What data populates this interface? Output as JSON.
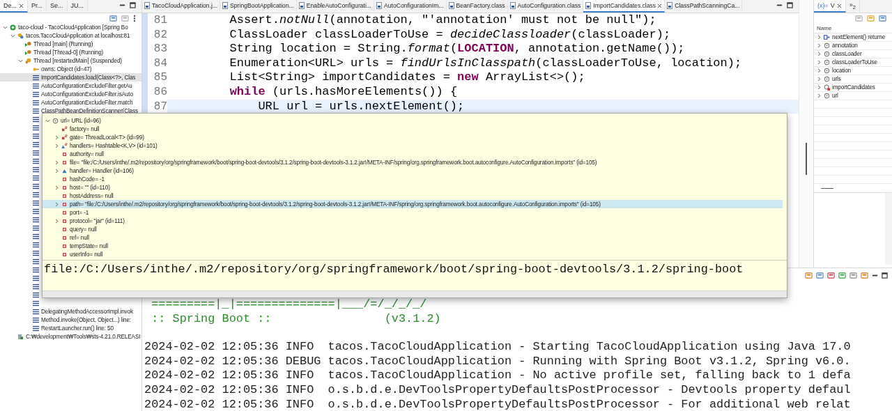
{
  "debug_view": {
    "tabs": [
      {
        "label": "De...",
        "selected": true,
        "closable": true
      },
      {
        "label": "Pr...",
        "selected": false,
        "closable": false
      },
      {
        "label": "Se...",
        "selected": false,
        "closable": false
      },
      {
        "label": "JU...",
        "selected": false,
        "closable": false
      }
    ],
    "tree": [
      {
        "label": "taco-cloud - TacoCloudApplication [Spring Bo",
        "kind": "launch",
        "expanded": true,
        "children": [
          {
            "label": "tacos.TacoCloudApplication at localhost:81",
            "kind": "process",
            "expanded": true,
            "children": [
              {
                "label": "Thread [main] (Running)",
                "kind": "thread"
              },
              {
                "label": "Thread [Thread-0] (Running)",
                "kind": "thread"
              },
              {
                "label": "Thread [restartedMain] (Suspended)",
                "kind": "suspended",
                "expanded": true,
                "children": [
                  {
                    "label": "owns: Object  (id=47)",
                    "kind": "monitor",
                    "selected": false
                  },
                  {
                    "label": "ImportCandidates.load(Class<?>, Clas",
                    "kind": "frame",
                    "selected": true
                  },
                  {
                    "label": "AutoConfigurationExcludeFilter.getAu",
                    "kind": "frame",
                    "selected": false
                  },
                  {
                    "label": "AutoConfigurationExcludeFilter.isAuto",
                    "kind": "frame",
                    "selected": false
                  },
                  {
                    "label": "AutoConfigurationExcludeFilter.match",
                    "kind": "frame",
                    "selected": false
                  },
                  {
                    "label": "ClassPathBeanDefinitionScanner(Class",
                    "kind": "frame",
                    "selected": false
                  },
                  {
                    "kind": "covered"
                  },
                  {
                    "kind": "covered"
                  },
                  {
                    "kind": "covered"
                  },
                  {
                    "kind": "covered"
                  },
                  {
                    "kind": "covered"
                  },
                  {
                    "kind": "covered"
                  },
                  {
                    "kind": "covered"
                  },
                  {
                    "kind": "covered"
                  },
                  {
                    "kind": "covered"
                  },
                  {
                    "kind": "covered"
                  },
                  {
                    "kind": "covered"
                  },
                  {
                    "kind": "covered"
                  },
                  {
                    "kind": "covered"
                  },
                  {
                    "kind": "covered"
                  },
                  {
                    "kind": "covered"
                  },
                  {
                    "kind": "covered"
                  },
                  {
                    "kind": "covered"
                  },
                  {
                    "kind": "covered"
                  },
                  {
                    "kind": "covered"
                  },
                  {
                    "kind": "covered"
                  },
                  {
                    "kind": "covered"
                  },
                  {
                    "kind": "covered"
                  },
                  {
                    "kind": "covered"
                  },
                  {
                    "label": "DelegatingMethodAccessorImpl.invok",
                    "kind": "frame",
                    "selected": false
                  },
                  {
                    "label": "Method.invoke(Object, Object...) line:",
                    "kind": "frame",
                    "selected": false
                  },
                  {
                    "label": "RestartLauncher.run() line: 50",
                    "kind": "frame",
                    "selected": false
                  }
                ]
              }
            ]
          },
          {
            "label": "C:₩development₩Tools₩sts-4.21.0.RELEASI",
            "kind": "javaw"
          }
        ]
      }
    ]
  },
  "editor": {
    "tabs": [
      {
        "label": "TacoCloudApplication.j...",
        "selected": false
      },
      {
        "label": "SpringBootApplication...",
        "selected": false
      },
      {
        "label": "EnableAutoConfigurati...",
        "selected": false
      },
      {
        "label": "AutoConfigurationIm...",
        "selected": false
      },
      {
        "label": "BeanFactory.class",
        "selected": false
      },
      {
        "label": "AutoConfiguration.class",
        "selected": false
      },
      {
        "label": "ImportCandidates.class",
        "selected": true
      },
      {
        "label": "ClassPathScanningCa...",
        "selected": false
      }
    ],
    "lines": [
      {
        "number": "81",
        "code": "        Assert.*notNull*(annotation, \"'annotation' must not be null\");",
        "current": false
      },
      {
        "number": "82",
        "code": "        ClassLoader classLoaderToUse = *decideClassloader*(classLoader);",
        "current": false
      },
      {
        "number": "83",
        "code": "        String location = String.*format*(**LOCATION**, annotation.getName());",
        "current": false
      },
      {
        "number": "84",
        "code": "        Enumeration<URL> urls = *findUrlsInClasspath*(classLoaderToUse, location);",
        "current": false
      },
      {
        "number": "85",
        "code": "        List<String> importCandidates = **new** ArrayList<>();",
        "current": false
      },
      {
        "number": "86",
        "code": "        **while** (urls.hasMoreElements()) {",
        "current": false
      },
      {
        "number": "87",
        "code": "            URL url = urls.nextElement();",
        "current": true
      }
    ]
  },
  "variables_view": {
    "tab": {
      "icon_text": "(x)=",
      "label": "V",
      "selected": true
    },
    "overflow": "»$_{2}$",
    "column": "Name",
    "items": [
      {
        "name": "nextElement() returne",
        "kind": "return"
      },
      {
        "name": "annotation",
        "kind": "local"
      },
      {
        "name": "classLoader",
        "kind": "local"
      },
      {
        "name": "classLoaderToUse",
        "kind": "local"
      },
      {
        "name": "location",
        "kind": "local"
      },
      {
        "name": "urls",
        "kind": "local"
      },
      {
        "name": "importCandidates",
        "kind": "local-list"
      },
      {
        "name": "url",
        "kind": "local"
      }
    ]
  },
  "inspect_popup": {
    "tree": [
      {
        "label": "url= URL  (id=96)",
        "kind": "local",
        "expanded": true,
        "selected": false,
        "children": [
          {
            "label": "factory= null",
            "kind": "static",
            "expandable": false,
            "selected": false
          },
          {
            "label": "gate= ThreadLocal<T>  (id=99)",
            "kind": "static",
            "expandable": true,
            "expanded": false,
            "selected": false
          },
          {
            "label": "handlers= Hashtable<K,V>  (id=101)",
            "kind": "static-protected",
            "expandable": true,
            "expanded": false,
            "selected": false
          },
          {
            "label": "authority= null",
            "kind": "private",
            "expandable": false,
            "selected": false
          },
          {
            "label": "file= \"file:/C:/Users/inthe/.m2/repository/org/springframework/boot/spring-boot-devtools/3.1.2/spring-boot-devtools-3.1.2.jar!/META-INF/spring/org.springframework.boot.autoconfigure.AutoConfiguration.imports\" (id=105)",
            "kind": "private",
            "expandable": true,
            "expanded": false,
            "selected": false
          },
          {
            "label": "handler= Handler  (id=106)",
            "kind": "protected",
            "expandable": true,
            "expanded": false,
            "selected": false
          },
          {
            "label": "hashCode= -1",
            "kind": "private",
            "expandable": false,
            "selected": false
          },
          {
            "label": "host= \"\" (id=110)",
            "kind": "private",
            "expandable": true,
            "expanded": false,
            "selected": false
          },
          {
            "label": "hostAddress= null",
            "kind": "private",
            "expandable": false,
            "selected": false
          },
          {
            "label": "path= \"file:/C:/Users/inthe/.m2/repository/org/springframework/boot/spring-boot-devtools/3.1.2/spring-boot-devtools-3.1.2.jar!/META-INF/spring/org.springframework.boot.autoconfigure.AutoConfiguration.imports\" (id=105)",
            "kind": "private",
            "expandable": true,
            "expanded": false,
            "selected": true
          },
          {
            "label": "port= -1",
            "kind": "private",
            "expandable": false,
            "selected": false
          },
          {
            "label": "protocol= \"jar\" (id=111)",
            "kind": "private",
            "expandable": true,
            "expanded": false,
            "selected": false
          },
          {
            "label": "query= null",
            "kind": "private",
            "expandable": false,
            "selected": false
          },
          {
            "label": "ref= null",
            "kind": "private",
            "expandable": false,
            "selected": false
          },
          {
            "label": "tempState= null",
            "kind": "private",
            "expandable": false,
            "selected": false
          },
          {
            "label": "userInfo= null",
            "kind": "private",
            "expandable": false,
            "selected": false
          }
        ]
      }
    ],
    "detail": "file:/C:/Users/inthe/.m2/repository/org/springframework/boot/spring-boot-devtools/3.1.2/spring-boot"
  },
  "console": {
    "lines": [
      {
        "kind": "banner",
        "text": " =========|_|==============|___/=/_/_/_/"
      },
      {
        "kind": "banner",
        "text": " :: Spring Boot ::                (v3.1.2)"
      },
      {
        "kind": "log",
        "text": "2024-02-02 12:05:36 INFO  tacos.TacoCloudApplication - Starting TacoCloudApplication using Java 17.0"
      },
      {
        "kind": "log",
        "text": "2024-02-02 12:05:36 DEBUG tacos.TacoCloudApplication - Running with Spring Boot v3.1.2, Spring v6.0."
      },
      {
        "kind": "log",
        "text": "2024-02-02 12:05:36 INFO  tacos.TacoCloudApplication - No active profile set, falling back to 1 defa"
      },
      {
        "kind": "log",
        "text": "2024-02-02 12:05:36 INFO  o.s.b.d.e.DevToolsPropertyDefaultsPostProcessor - Devtools property defaul"
      },
      {
        "kind": "log",
        "text": "2024-02-02 12:05:36 INFO  o.s.b.d.e.DevToolsPropertyDefaultsPostProcessor - For additional web relat"
      }
    ]
  }
}
